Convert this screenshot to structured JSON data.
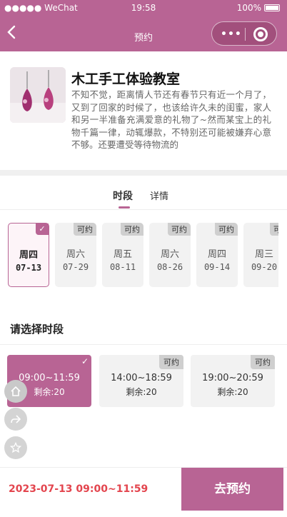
{
  "status_bar": {
    "carrier": "●●●●● WeChat",
    "time": "19:58",
    "battery": "100%"
  },
  "nav": {
    "back_icon": "chevron-left-icon",
    "title": "预约",
    "more": "•••"
  },
  "intro": {
    "title": "木工手工体验教室",
    "description": "不知不觉，距离情人节还有春节只有近一个月了，又到了回家的时候了，也该给许久未的闺蜜，家人和另一半准备充满爱意的礼物了~然而某宝上的礼物千篇一律，动辄爆款，不特别还可能被嫌弃心意不够。还要遭受等待物流的"
  },
  "tabs": [
    {
      "label": "时段"
    },
    {
      "label": "详情"
    }
  ],
  "dates": [
    {
      "weekday": "周四",
      "date": "07-13",
      "badge": "",
      "selected": true
    },
    {
      "weekday": "周六",
      "date": "07-29",
      "badge": "可约",
      "selected": false
    },
    {
      "weekday": "周五",
      "date": "08-11",
      "badge": "可约",
      "selected": false
    },
    {
      "weekday": "周六",
      "date": "08-26",
      "badge": "可约",
      "selected": false
    },
    {
      "weekday": "周四",
      "date": "09-14",
      "badge": "可约",
      "selected": false
    },
    {
      "weekday": "周三",
      "date": "09-20",
      "badge": "可",
      "selected": false
    }
  ],
  "section_title": "请选择时段",
  "slots": [
    {
      "range": "09:00~11:59",
      "remaining": "剩余:20",
      "badge": "",
      "selected": true
    },
    {
      "range": "14:00~18:59",
      "remaining": "剩余:20",
      "badge": "可约",
      "selected": false
    },
    {
      "range": "19:00~20:59",
      "remaining": "剩余:20",
      "badge": "可约",
      "selected": false
    }
  ],
  "selected_summary": "2023-07-13 09:00~11:59",
  "book_button": "去预约",
  "colors": {
    "accent": "#b86494",
    "price_red": "#e3454e"
  }
}
